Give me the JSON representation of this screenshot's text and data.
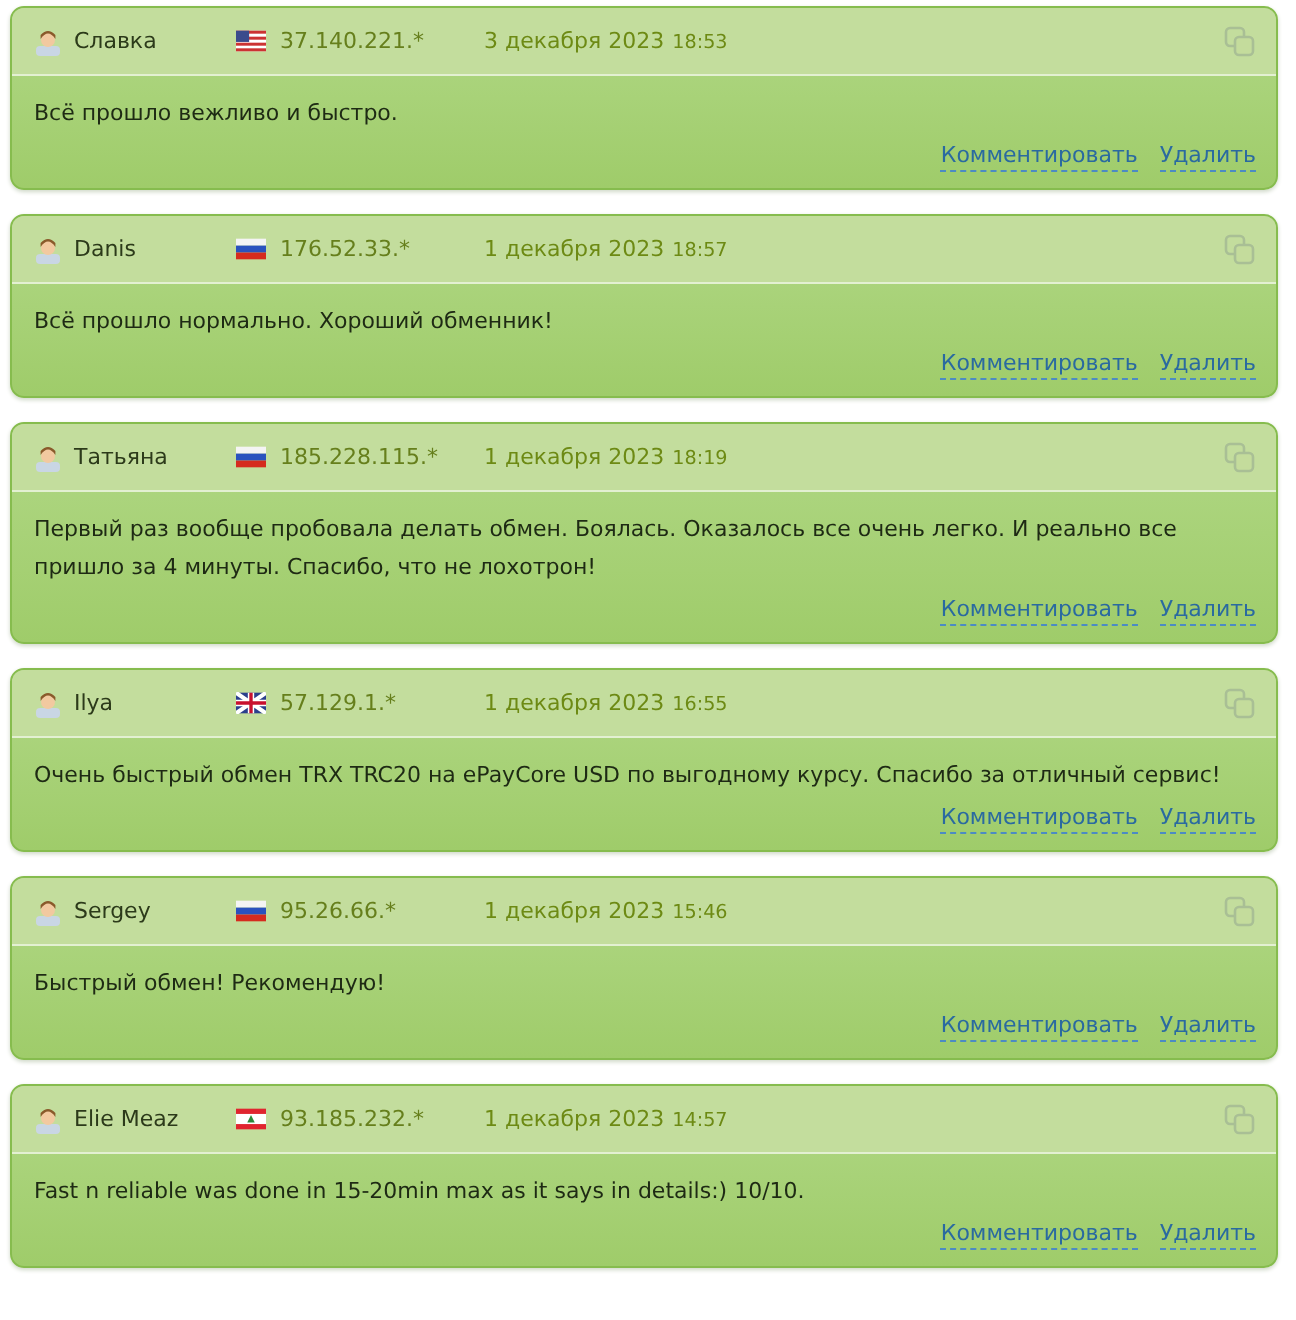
{
  "reviews": [
    {
      "author": "Славка",
      "kind": "us",
      "ip": "37.140.221.*",
      "date": "3 декабря 2023",
      "time": "18:53",
      "text": "Всё прошло вежливо и быстро.",
      "actions": [
        "Комментировать",
        "Удалить"
      ]
    },
    {
      "author": "Danis",
      "kind": "ru",
      "ip": "176.52.33.*",
      "date": "1 декабря 2023",
      "time": "18:57",
      "text": "Всё прошло нормально. Хороший обменник!",
      "actions": [
        "Комментировать",
        "Удалить"
      ]
    },
    {
      "author": "Татьяна",
      "kind": "ru",
      "ip": "185.228.115.*",
      "date": "1 декабря 2023",
      "time": "18:19",
      "text": "Первый раз вообще пробовала делать обмен. Боялась. Оказалось все очень легко. И реально все пришло за 4 минуты. Спасибо, что не лохотрон!",
      "actions": [
        "Комментировать",
        "Удалить"
      ]
    },
    {
      "author": "Ilya",
      "kind": "gb",
      "ip": "57.129.1.*",
      "date": "1 декабря 2023",
      "time": "16:55",
      "text": "Очень быстрый обмен TRX TRC20 на ePayCore USD по выгодному курсу. Спасибо за отличный сервис!",
      "actions": [
        "Комментировать",
        "Удалить"
      ]
    },
    {
      "author": "Sergey",
      "kind": "ru",
      "ip": "95.26.66.*",
      "date": "1 декабря 2023",
      "time": "15:46",
      "text": "Быстрый обмен! Рекомендую!",
      "actions": [
        "Комментировать",
        "Удалить"
      ]
    },
    {
      "author": "Elie Meaz",
      "kind": "lb",
      "ip": "93.185.232.*",
      "date": "1 декабря 2023",
      "time": "14:57",
      "text": "Fast n reliable was done in 15-20min max as it says in details:) 10/10.",
      "actions": [
        "Комментировать",
        "Удалить"
      ]
    }
  ]
}
